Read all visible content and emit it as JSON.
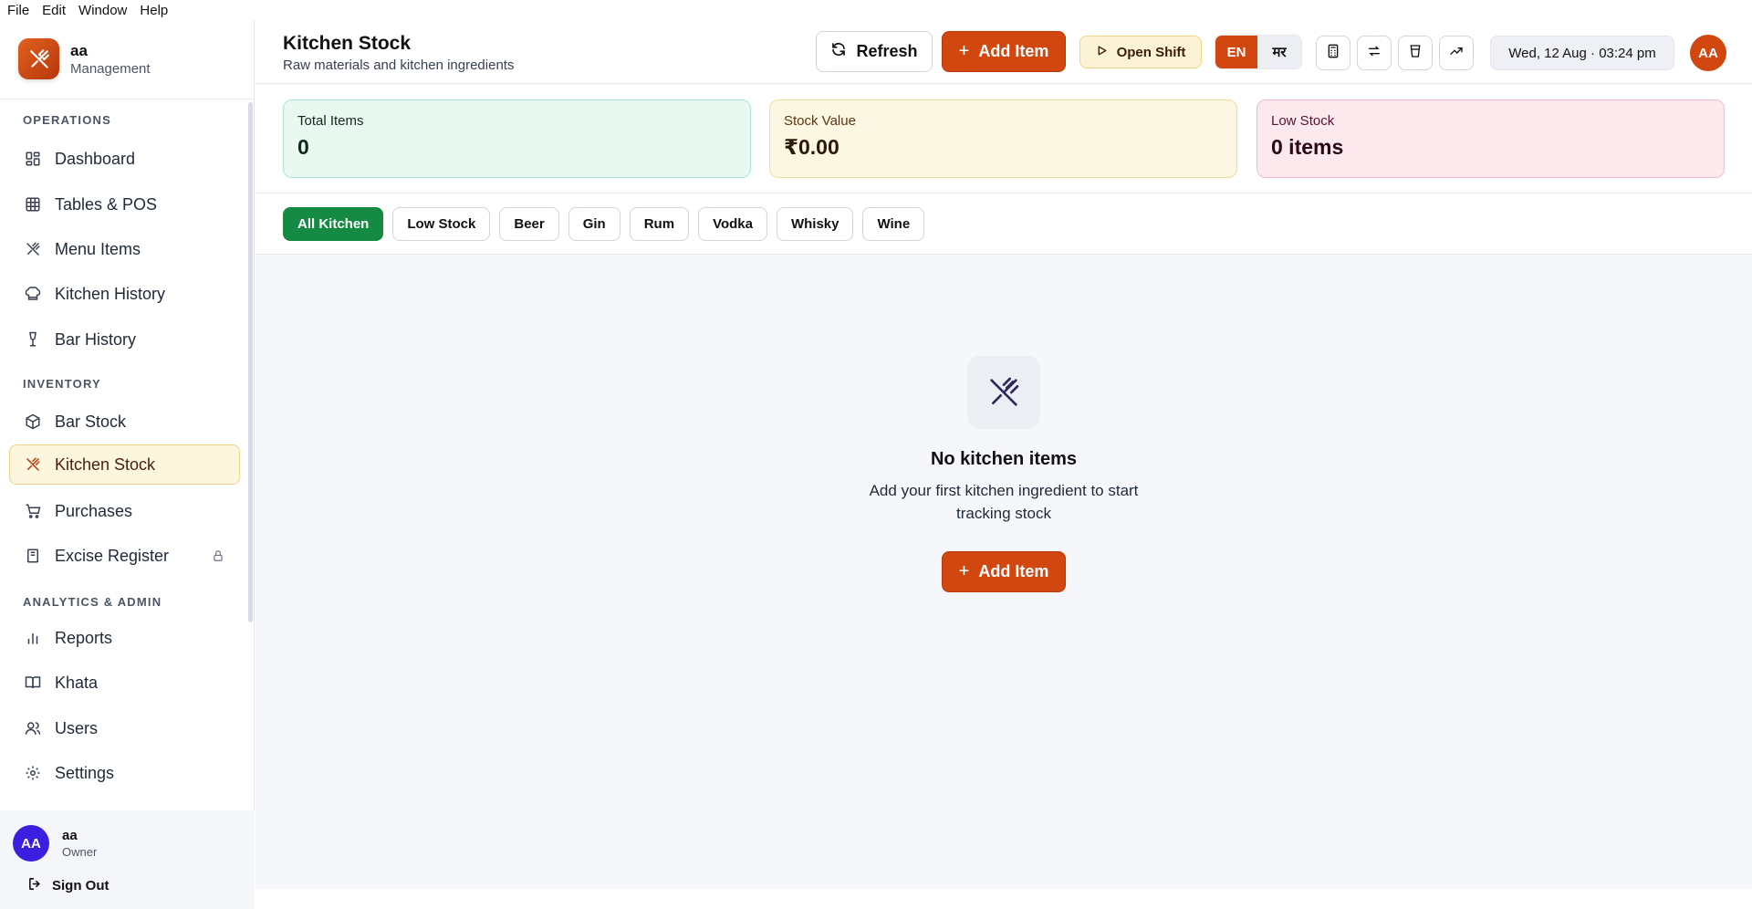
{
  "menubar": {
    "items": [
      "File",
      "Edit",
      "Window",
      "Help"
    ]
  },
  "brand": {
    "name": "aa",
    "subtitle": "Management"
  },
  "sidebar": {
    "sections": [
      {
        "title": "OPERATIONS",
        "items": [
          {
            "label": "Dashboard",
            "icon": "grid-icon"
          },
          {
            "label": "Tables & POS",
            "icon": "table-icon"
          },
          {
            "label": "Menu Items",
            "icon": "utensils-icon"
          },
          {
            "label": "Kitchen History",
            "icon": "chef-hat-icon"
          },
          {
            "label": "Bar History",
            "icon": "wine-glass-icon"
          }
        ]
      },
      {
        "title": "INVENTORY",
        "items": [
          {
            "label": "Bar Stock",
            "icon": "box-icon"
          },
          {
            "label": "Kitchen Stock",
            "icon": "utensils-icon",
            "active": true
          },
          {
            "label": "Purchases",
            "icon": "cart-icon"
          },
          {
            "label": "Excise Register",
            "icon": "book-icon",
            "locked": true
          }
        ]
      },
      {
        "title": "ANALYTICS & ADMIN",
        "items": [
          {
            "label": "Reports",
            "icon": "bar-chart-icon"
          },
          {
            "label": "Khata",
            "icon": "open-book-icon"
          },
          {
            "label": "Users",
            "icon": "users-icon"
          },
          {
            "label": "Settings",
            "icon": "gear-icon"
          }
        ]
      }
    ]
  },
  "user": {
    "initials": "AA",
    "name": "aa",
    "role": "Owner",
    "sign_out": "Sign Out"
  },
  "header": {
    "title": "Kitchen Stock",
    "subtitle": "Raw materials and kitchen ingredients",
    "refresh_label": "Refresh",
    "add_item_label": "Add Item",
    "open_shift_label": "Open Shift",
    "lang_en": "EN",
    "lang_mr": "मर",
    "datetime": "Wed, 12 Aug · 03:24 pm",
    "avatar_initials": "AA"
  },
  "stats": {
    "total_items": {
      "label": "Total Items",
      "value": "0"
    },
    "stock_value": {
      "label": "Stock Value",
      "value": "₹0.00"
    },
    "low_stock": {
      "label": "Low Stock",
      "value": "0 items"
    }
  },
  "filters": [
    "All Kitchen",
    "Low Stock",
    "Beer",
    "Gin",
    "Rum",
    "Vodka",
    "Whisky",
    "Wine"
  ],
  "active_filter": "All Kitchen",
  "empty_state": {
    "title": "No kitchen items",
    "description": "Add your first kitchen ingredient to start tracking stock",
    "button_label": "Add Item"
  },
  "colors": {
    "accent": "#d2470f",
    "active_chip": "#148a43",
    "avatar_user": "#3b1fe0"
  }
}
